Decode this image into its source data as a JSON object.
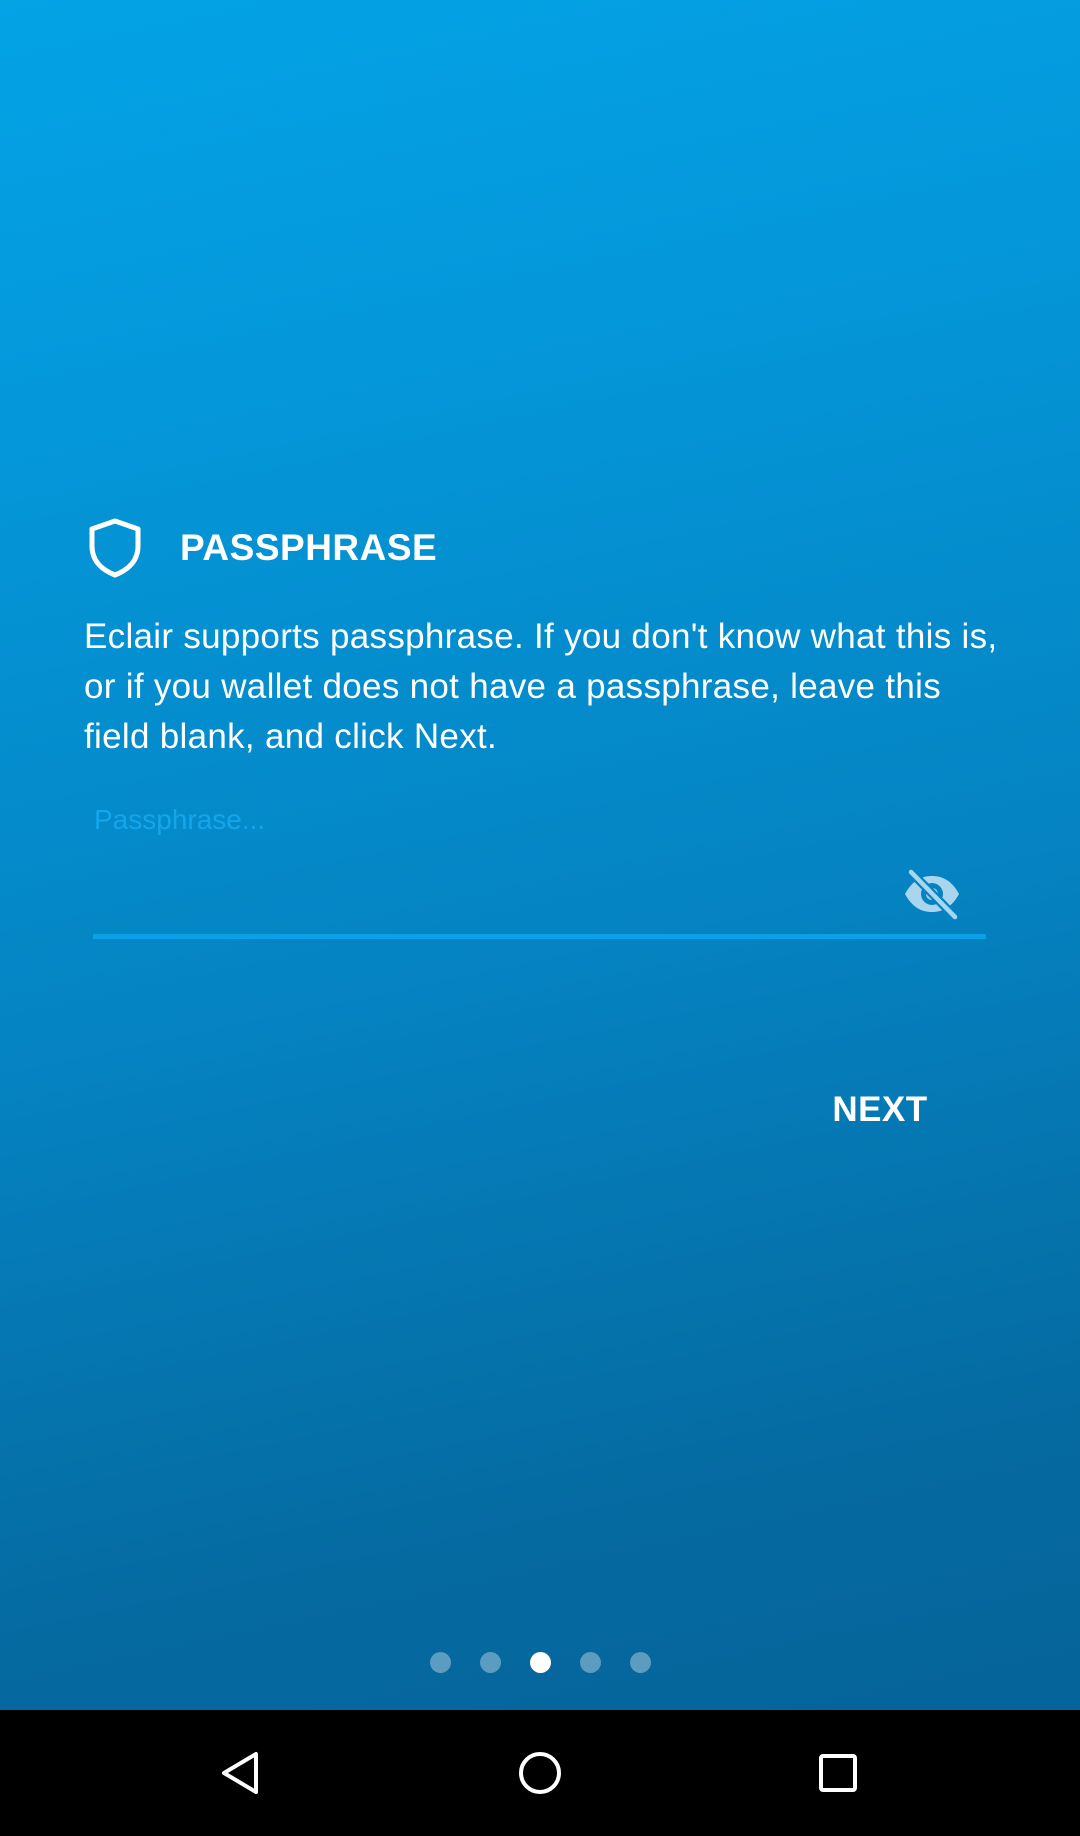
{
  "app": {
    "name": "Eclair"
  },
  "header": {
    "icon": "shield-icon",
    "title": "PASSPHRASE"
  },
  "description": "Eclair supports passphrase. If you don't know what this is, or if you wallet does not have a passphrase, leave this field blank, and click Next.",
  "passphrase_field": {
    "label": "Passphrase...",
    "value": "",
    "toggle_icon": "visibility-off-icon"
  },
  "next_button": {
    "label": "NEXT"
  },
  "pager": {
    "count": 5,
    "active_index": 2
  },
  "navigation_bar": {
    "back_icon": "back-triangle-icon",
    "home_icon": "home-circle-icon",
    "recents_icon": "recents-square-icon"
  },
  "colors": {
    "background_top": "#03a3e6",
    "background_bottom": "#05649a",
    "field_accent": "#0aa1e8",
    "label_color": "#14a6ec",
    "text": "#ffffff"
  }
}
